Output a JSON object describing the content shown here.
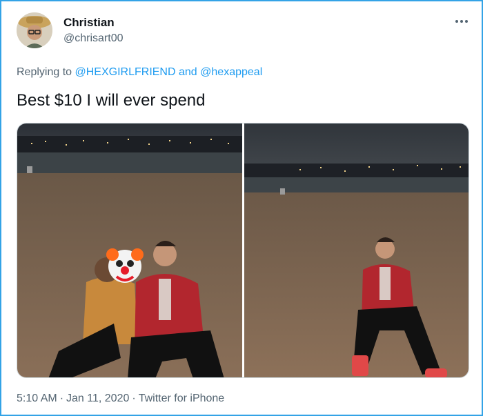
{
  "tweet": {
    "author_name": "Christian",
    "author_handle": "@chrisart00",
    "replying_prefix": "Replying to",
    "reply_user_1": "@HEXGIRLFRIEND",
    "reply_conjunction": "and",
    "reply_user_2": "@hexappeal",
    "text": "Best $10 I will ever spend",
    "time": "5:10 AM",
    "separator": "·",
    "date": "Jan 11, 2020",
    "source": "Twitter for iPhone"
  },
  "media": {
    "photos": [
      {
        "subject": "beach-night-photo-with-two-people",
        "overlay_icon": "clown-face-emoji"
      },
      {
        "subject": "beach-night-photo-one-person"
      }
    ]
  },
  "colors": {
    "border": "#33a3e6",
    "link": "#1d9bf0",
    "secondary_text": "#536471"
  },
  "icons": {
    "more": "more-options-icon"
  }
}
